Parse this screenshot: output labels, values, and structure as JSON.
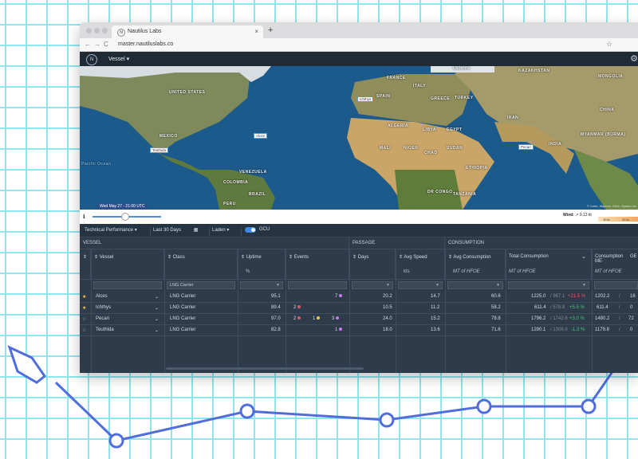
{
  "browser": {
    "tab_title": "Nautilus Labs",
    "tab_close": "×",
    "new_tab": "+",
    "url": "master.nautiluslabs.co",
    "nav_back": "←",
    "nav_forward": "→",
    "nav_reload": "C",
    "bookmark_star": "☆"
  },
  "app": {
    "logo": "N",
    "vessel_selector": "Vessel ▾",
    "settings_icon": "gear-icon"
  },
  "map": {
    "labels": [
      "UNITED STATES",
      "MEXICO",
      "VENEZUELA",
      "COLOMBIA",
      "PERU",
      "BRAZIL",
      "FRANCE",
      "ITALY",
      "SPAIN",
      "GREECE",
      "TURKEY",
      "ALGERIA",
      "LIBYA",
      "EGYPT",
      "MALI",
      "NIGER",
      "CHAD",
      "SUDAN",
      "ETHIOPIA",
      "DR CONGO",
      "TANZANIA",
      "IRAN",
      "INDIA",
      "CHINA",
      "MONGOLIA",
      "MYANMAR (BURMA)",
      "KAZAKHSTAN",
      "Pacific Ocean",
      "Ukraine"
    ],
    "vessel_markers": [
      "Teuthida",
      "Alces",
      "Ichthys",
      "Pecari"
    ],
    "attribution": "© Carto, Mapbox, Here, Sparks Inc"
  },
  "timeline": {
    "info_icon": "ℹ",
    "time_label": "Wed May 27 - 21:00 UTC",
    "wind_label": "Wind:",
    "wind_value": "↗ 9.13 kt",
    "wind_scale": [
      "10 kt",
      "20 kt"
    ]
  },
  "filters": {
    "view": "Technical Performance",
    "date_range": "Last 30 Days",
    "calendar_icon": "calendar-icon",
    "condition": "Laden",
    "toggle_label": "GCU"
  },
  "table": {
    "groups": [
      "VESSEL",
      "PASSAGE",
      "CONSUMPTION"
    ],
    "columns": [
      {
        "label": "⇕",
        "unit": ""
      },
      {
        "label": "⇕  Vessel",
        "unit": ""
      },
      {
        "label": "⇕  Class",
        "unit": ""
      },
      {
        "label": "⇕  Uptime",
        "unit": "%"
      },
      {
        "label": "⇕  Events",
        "unit": ""
      },
      {
        "label": "⇕  Days",
        "unit": ""
      },
      {
        "label": "⇕  Avg Speed",
        "unit": "kts"
      },
      {
        "label": "⇕  Avg Consumption",
        "unit": "MT of HFOE"
      },
      {
        "label": "Total Consumption",
        "unit": "MT of HFOE"
      },
      {
        "label": "Consumption ME",
        "unit": "MT of HFOE"
      },
      {
        "label": "GE",
        "unit": ""
      }
    ],
    "class_filter": "LNG Carrier",
    "rows": [
      {
        "starred": true,
        "vessel": "Alces",
        "class": "LNG Carrier",
        "uptime": "95.1",
        "events": [
          "",
          "",
          "7"
        ],
        "days": "20.2",
        "speed": "14.7",
        "avg": "60.6",
        "total": "1225.0",
        "total_ref": "987.1",
        "delta": "+21.5 %",
        "delta_sign": "neg",
        "me": "1202.2",
        "ge": "16"
      },
      {
        "starred": true,
        "vessel": "Ichthys",
        "class": "LNG Carrier",
        "uptime": "89.4",
        "events": [
          "2",
          "",
          ""
        ],
        "days": "10.5",
        "speed": "11.2",
        "avg": "58.2",
        "total": "611.4",
        "total_ref": "578.8",
        "delta": "+5.5 %",
        "delta_sign": "pos",
        "me": "611.4",
        "ge": "0"
      },
      {
        "starred": false,
        "vessel": "Pecari",
        "class": "LNG Carrier",
        "uptime": "97.0",
        "events": [
          "2",
          "1",
          "3"
        ],
        "days": "24.0",
        "speed": "15.2",
        "avg": "78.8",
        "total": "1796.2",
        "total_ref": "1742.6",
        "delta": "+3.0 %",
        "delta_sign": "pos",
        "me": "1480.2",
        "ge": "72"
      },
      {
        "starred": false,
        "vessel": "Teuthida",
        "class": "LNG Carrier",
        "uptime": "82.8",
        "events": [
          "",
          "",
          "1"
        ],
        "days": "18.0",
        "speed": "13.6",
        "avg": "71.6",
        "total": "1290.1",
        "total_ref": "1306.9",
        "delta": "-1.3 %",
        "delta_sign": "pos",
        "me": "1179.8",
        "ge": "0"
      }
    ]
  }
}
